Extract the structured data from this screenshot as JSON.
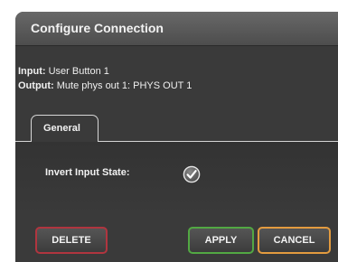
{
  "dialog": {
    "title": "Configure Connection"
  },
  "connection": {
    "input_label": "Input:",
    "input_value": "User Button 1",
    "output_label": "Output:",
    "output_value": "Mute phys out 1: PHYS OUT 1"
  },
  "tabs": [
    {
      "label": "General",
      "active": true
    }
  ],
  "general": {
    "invert_label": "Invert Input State:",
    "invert_checked": true,
    "check_icon": "check-circle-icon"
  },
  "buttons": {
    "delete": "DELETE",
    "apply": "APPLY",
    "cancel": "CANCEL"
  },
  "colors": {
    "delete_border": "#b0353f",
    "apply_border": "#52a843",
    "cancel_border": "#e39b3f",
    "dialog_bg": "#3a3a3a"
  }
}
